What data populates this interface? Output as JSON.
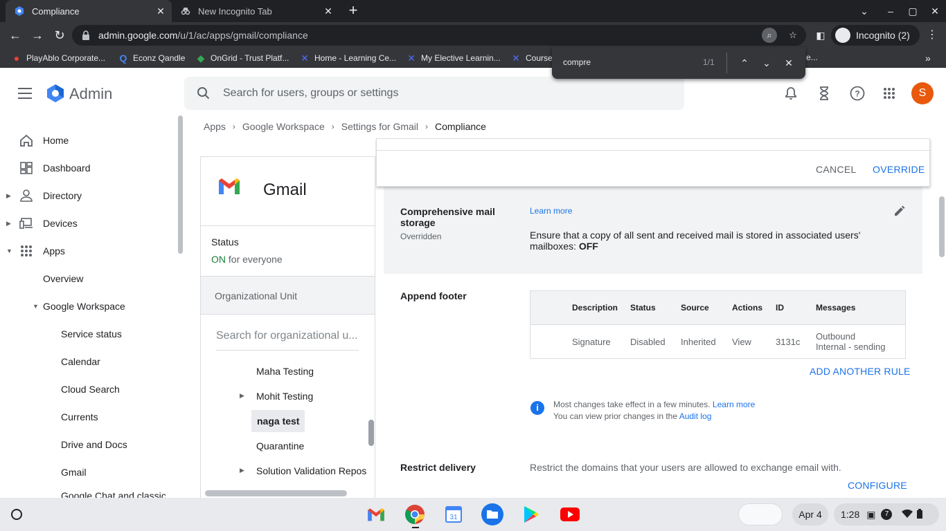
{
  "browser": {
    "tabs": [
      {
        "title": "Compliance",
        "active": true
      },
      {
        "title": "New Incognito Tab",
        "active": false
      }
    ],
    "url_host": "admin.google.com",
    "url_path": "/u/1/ac/apps/gmail/compliance",
    "profile_label": "Incognito (2)",
    "bookmarks": [
      "PlayAblo Corporate...",
      "Econz Qandle",
      "OnGrid - Trust Platf...",
      "Home - Learning Ce...",
      "My Elective Learnin...",
      "Course",
      "e..."
    ],
    "find": {
      "query": "compre",
      "count": "1/1"
    }
  },
  "header": {
    "title": "Admin",
    "search_placeholder": "Search for users, groups or settings",
    "avatar_letter": "S"
  },
  "sidebar": {
    "items": [
      {
        "label": "Home"
      },
      {
        "label": "Dashboard"
      },
      {
        "label": "Directory"
      },
      {
        "label": "Devices"
      },
      {
        "label": "Apps"
      },
      {
        "label": "Overview"
      },
      {
        "label": "Google Workspace"
      },
      {
        "label": "Service status"
      },
      {
        "label": "Calendar"
      },
      {
        "label": "Cloud Search"
      },
      {
        "label": "Currents"
      },
      {
        "label": "Drive and Docs"
      },
      {
        "label": "Gmail"
      },
      {
        "label": "Google Chat and classic"
      }
    ]
  },
  "breadcrumb": [
    "Apps",
    "Google Workspace",
    "Settings for Gmail",
    "Compliance"
  ],
  "gmail_panel": {
    "name": "Gmail",
    "status_label": "Status",
    "status_on": "ON",
    "status_scope": "for everyone",
    "ou_header": "Organizational Unit",
    "ou_search_placeholder": "Search for organizational u...",
    "ou_items": [
      "Maha Testing",
      "Mohit Testing",
      "naga test",
      "Quarantine",
      "Solution Validation Repos"
    ]
  },
  "main": {
    "cancel": "CANCEL",
    "override": "OVERRIDE",
    "comp_title_1": "Comprehensive mail",
    "comp_title_2": "storage",
    "comp_status": "Overridden",
    "learn_more": "Learn more",
    "comp_desc_1": "Ensure that a copy of all sent and received mail is stored in associated users'",
    "comp_desc_2": "mailboxes:",
    "comp_desc_value": "OFF",
    "footer_title": "Append footer",
    "table_headers": [
      "Description",
      "Status",
      "Source",
      "Actions",
      "ID",
      "Messages"
    ],
    "table_row": {
      "description": "Signature",
      "status": "Disabled",
      "source": "Inherited",
      "action": "View",
      "id": "3131c",
      "messages_1": "Outbound",
      "messages_2": "Internal - sending"
    },
    "add_rule": "ADD ANOTHER RULE",
    "info_1": "Most changes take effect in a few minutes.",
    "info_learn_more": "Learn more",
    "info_2": "You can view prior changes in the",
    "audit_log": "Audit log",
    "restrict_title": "Restrict delivery",
    "restrict_desc": "Restrict the domains that your users are allowed to exchange email with.",
    "configure": "CONFIGURE"
  },
  "shelf": {
    "date": "Apr 4",
    "time": "1:28",
    "notif_count": "7"
  },
  "colors": {
    "accent": "#1a73e8",
    "on_green": "#188038",
    "avatar": "#e8590c"
  }
}
